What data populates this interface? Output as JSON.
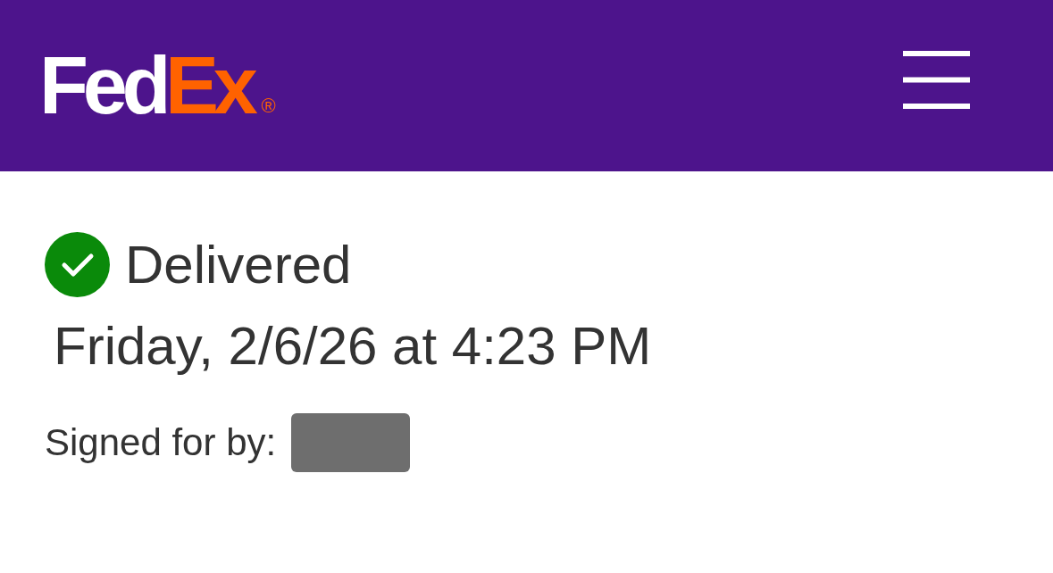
{
  "header": {
    "logo": {
      "parts": [
        {
          "text": "Fed",
          "color": "#ffffff"
        },
        {
          "text": "Ex",
          "color": "#ff6200"
        }
      ],
      "mark": "®"
    }
  },
  "status": {
    "kind": "delivered",
    "label": "Delivered",
    "date": "Friday, 2/6/26 at 4:23 PM"
  },
  "signature": {
    "label": "Signed for by:"
  }
}
